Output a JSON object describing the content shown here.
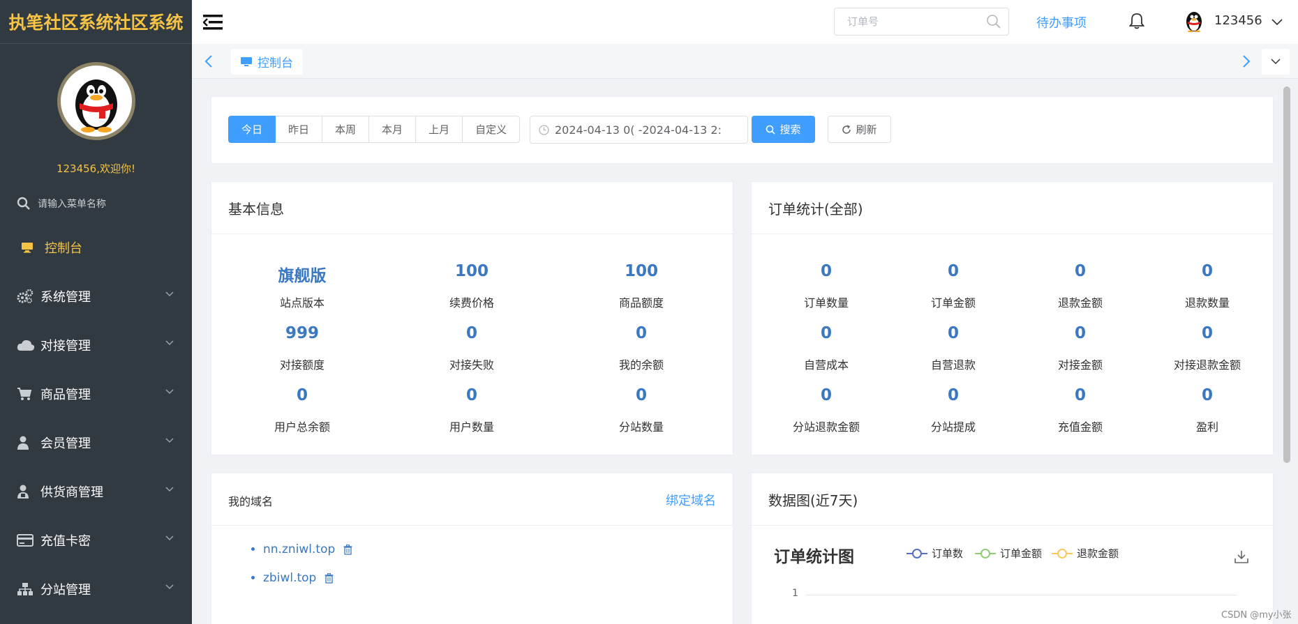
{
  "sidebar": {
    "logo": "执笔社区系统社区系统",
    "welcome": "123456,欢迎你!",
    "search_placeholder": "请输入菜单名称",
    "items": [
      {
        "label": "控制台",
        "icon": "monitor-icon"
      },
      {
        "label": "系统管理",
        "icon": "gears-icon"
      },
      {
        "label": "对接管理",
        "icon": "cloud-icon"
      },
      {
        "label": "商品管理",
        "icon": "cart-icon"
      },
      {
        "label": "会员管理",
        "icon": "user-icon"
      },
      {
        "label": "供货商管理",
        "icon": "supplier-icon"
      },
      {
        "label": "充值卡密",
        "icon": "card-icon"
      },
      {
        "label": "分站管理",
        "icon": "sitemap-icon"
      }
    ]
  },
  "header": {
    "order_placeholder": "订单号",
    "todo": "待办事项",
    "username": "123456"
  },
  "tabs": {
    "active": "控制台"
  },
  "filter": {
    "segments": [
      "今日",
      "昨日",
      "本周",
      "本月",
      "上月",
      "自定义"
    ],
    "date_range": "2024-04-13 0( -2024-04-13 2:",
    "search_label": "搜索",
    "refresh_label": "刷新"
  },
  "basic": {
    "title": "基本信息",
    "stats": [
      {
        "value": "旗舰版",
        "label": "站点版本"
      },
      {
        "value": "100",
        "label": "续费价格"
      },
      {
        "value": "100",
        "label": "商品额度"
      },
      {
        "value": "999",
        "label": "对接额度"
      },
      {
        "value": "0",
        "label": "对接失败"
      },
      {
        "value": "0",
        "label": "我的余额"
      },
      {
        "value": "0",
        "label": "用户总余额"
      },
      {
        "value": "0",
        "label": "用户数量"
      },
      {
        "value": "0",
        "label": "分站数量"
      }
    ]
  },
  "orders": {
    "title": "订单统计(全部)",
    "stats": [
      {
        "value": "0",
        "label": "订单数量"
      },
      {
        "value": "0",
        "label": "订单金额"
      },
      {
        "value": "0",
        "label": "退款金额"
      },
      {
        "value": "0",
        "label": "退款数量"
      },
      {
        "value": "0",
        "label": "自营成本"
      },
      {
        "value": "0",
        "label": "自营退款"
      },
      {
        "value": "0",
        "label": "对接金额"
      },
      {
        "value": "0",
        "label": "对接退款金额"
      },
      {
        "value": "0",
        "label": "分站退款金额"
      },
      {
        "value": "0",
        "label": "分站提成"
      },
      {
        "value": "0",
        "label": "充值金额"
      },
      {
        "value": "0",
        "label": "盈利"
      }
    ]
  },
  "domains": {
    "title": "我的域名",
    "bind_label": "绑定域名",
    "items": [
      "nn.zniwl.top",
      "zbiwl.top"
    ]
  },
  "chart_panel": {
    "title": "数据图(近7天)"
  },
  "chart_data": {
    "type": "line",
    "title": "订单统计图",
    "series": [
      {
        "name": "订单数",
        "color": "#5470c6"
      },
      {
        "name": "订单金额",
        "color": "#91cc75"
      },
      {
        "name": "退款金额",
        "color": "#fac858"
      }
    ],
    "y_ticks": [
      "1"
    ]
  },
  "watermark": "CSDN @my小张"
}
